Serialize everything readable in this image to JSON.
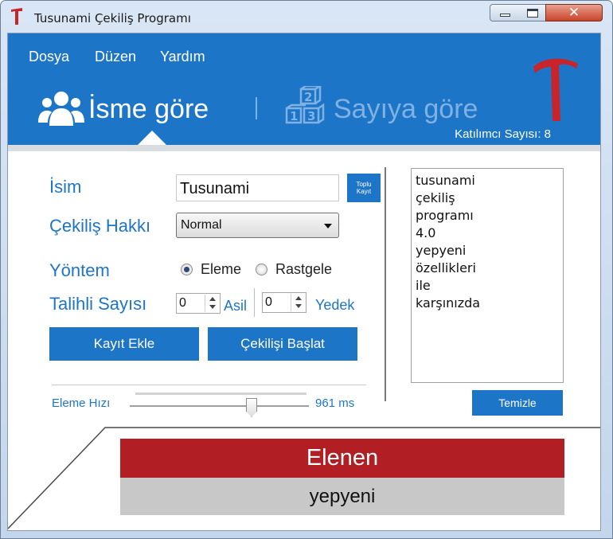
{
  "window": {
    "title": "Tusunami Çekiliş Programı",
    "close_glyph": "✕",
    "controls": [
      "minimize-button",
      "maximize-button",
      "close-button"
    ]
  },
  "menu": {
    "items": [
      {
        "label": "Dosya"
      },
      {
        "label": "Düzen"
      },
      {
        "label": "Yardım"
      }
    ]
  },
  "header": {
    "tabs": [
      {
        "label": "İsme göre",
        "icon": "people-icon",
        "active": true
      },
      {
        "label": "Sayıya göre",
        "icon": "number-blocks-icon",
        "active": false
      }
    ],
    "participant_count_text": "Katılımcı Sayısı: 8"
  },
  "form": {
    "name_label": "İsim",
    "name_value": "Tusunami",
    "bulk_button_line1": "Toplu",
    "bulk_button_line2": "Kayıt",
    "draw_right_label": "Çekiliş Hakkı",
    "draw_right_value": "Normal",
    "method_label": "Yöntem",
    "method_options": [
      {
        "label": "Eleme",
        "checked": true
      },
      {
        "label": "Rastgele",
        "checked": false
      }
    ],
    "winners_label": "Talihli Sayısı",
    "main_count": "0",
    "main_label": "Asil",
    "backup_count": "0",
    "backup_label": "Yedek",
    "add_button": "Kayıt Ekle",
    "start_button": "Çekilişi Başlat",
    "speed_label": "Eleme Hızı",
    "speed_value": "961 ms",
    "speed_fraction": 0.68
  },
  "entries": {
    "items": [
      "tusunami",
      "çekiliş",
      "programı",
      "4.0",
      "yepyeni",
      "özellikleri",
      "ile",
      "karşınızda"
    ],
    "clear_button": "Temizle"
  },
  "result": {
    "title": "Elenen",
    "value": "yepyeni"
  },
  "colors": {
    "accent": "#1d75c8",
    "eliminated": "#b11f24",
    "result_bg": "#c8c8c8"
  }
}
